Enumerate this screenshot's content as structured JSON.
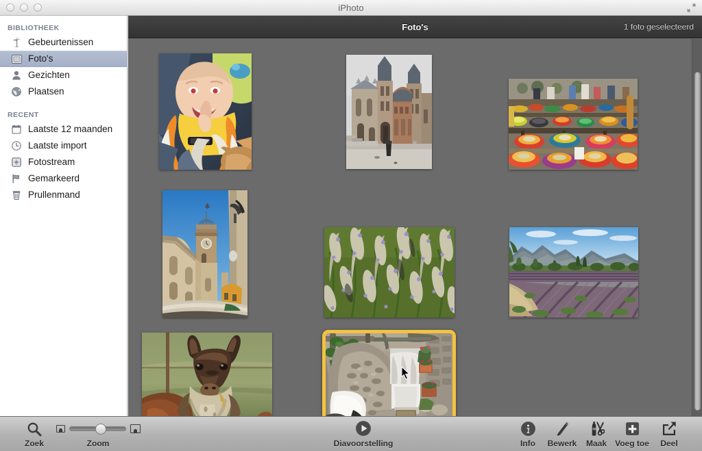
{
  "window": {
    "title": "iPhoto",
    "traffic_lights": [
      "close",
      "minimize",
      "zoom"
    ],
    "fullscreen_icon": "fullscreen-arrows-icon"
  },
  "sidebar": {
    "sections": [
      {
        "header": "BIBLIOTHEEK",
        "items": [
          {
            "label": "Gebeurtenissen",
            "icon": "palm-tree-icon",
            "selected": false
          },
          {
            "label": "Foto's",
            "icon": "photo-square-icon",
            "selected": true
          },
          {
            "label": "Gezichten",
            "icon": "person-icon",
            "selected": false
          },
          {
            "label": "Plaatsen",
            "icon": "globe-icon",
            "selected": false
          }
        ]
      },
      {
        "header": "RECENT",
        "items": [
          {
            "label": "Laatste 12 maanden",
            "icon": "calendar-icon",
            "selected": false
          },
          {
            "label": "Laatste import",
            "icon": "clock-icon",
            "selected": false
          },
          {
            "label": "Fotostream",
            "icon": "photostream-icon",
            "selected": false
          },
          {
            "label": "Gemarkeerd",
            "icon": "flag-icon",
            "selected": false
          },
          {
            "label": "Prullenmand",
            "icon": "trash-icon",
            "selected": false
          }
        ]
      }
    ]
  },
  "content_header": {
    "title": "Foto's",
    "status": "1 foto geselecteerd"
  },
  "photos": [
    {
      "name": "baby-in-yellow-bib",
      "alt": "Lachende baby met gele slab",
      "selected": false
    },
    {
      "name": "church-with-two-towers",
      "alt": "Romaanse kerk met twee torens op plein",
      "selected": false
    },
    {
      "name": "market-pottery-bowls",
      "alt": "Marktkraam met kleurrijke aardewerken schalen",
      "selected": false
    },
    {
      "name": "clock-tower-church",
      "alt": "Provencaalse kerk met klokkentoren",
      "selected": false
    },
    {
      "name": "lavender-closeup",
      "alt": "Close-up van lavendelstengels",
      "selected": false
    },
    {
      "name": "lavender-field-mountains",
      "alt": "Lavendelveld met bergen op de achtergrond",
      "selected": false
    },
    {
      "name": "llama-portrait",
      "alt": "Lama kijkt in de camera",
      "selected": false
    },
    {
      "name": "stone-archway-alley",
      "alt": "Stenen boog met wit doek en potplanten",
      "selected": true
    }
  ],
  "scrollbar": {
    "orientation": "vertical",
    "thumb_position_percent": 9
  },
  "toolbar": {
    "search": {
      "label": "Zoek",
      "icon": "magnifier-icon"
    },
    "zoom": {
      "label": "Zoom",
      "small_icon": "small-thumbnail-icon",
      "large_icon": "large-thumbnail-icon",
      "value_percent": 45
    },
    "slideshow": {
      "label": "Diavoorstelling",
      "icon": "play-circle-icon"
    },
    "actions": [
      {
        "label": "Info",
        "icon": "info-circle-icon"
      },
      {
        "label": "Bewerk",
        "icon": "pencil-icon"
      },
      {
        "label": "Maak",
        "icon": "scissors-glue-icon"
      },
      {
        "label": "Voeg toe",
        "icon": "plus-square-icon"
      },
      {
        "label": "Deel",
        "icon": "share-arrow-icon"
      }
    ]
  },
  "colors": {
    "selection_border": "#f2c33e",
    "sidebar_selection": "#a4b0c8",
    "content_background": "#6b6b6b",
    "header_background": "#3a3a3a"
  }
}
